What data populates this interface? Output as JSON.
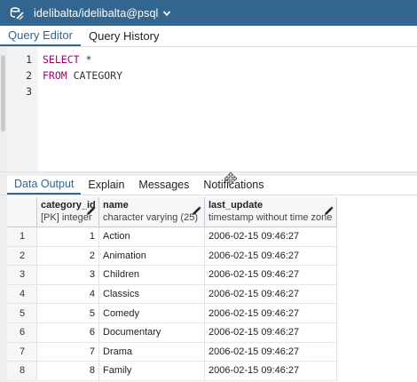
{
  "titlebar": {
    "connection": "idelibalta/idelibalta@psql",
    "db_icon": "database-connect-icon",
    "chevron": "chevron-down-icon",
    "bg_color": "#326690"
  },
  "editor_tabs": [
    {
      "label": "Query Editor",
      "active": true
    },
    {
      "label": "Query History",
      "active": false
    }
  ],
  "editor": {
    "lines": [
      {
        "num": "1",
        "keyword": "SELECT",
        "rest": " *"
      },
      {
        "num": "2",
        "keyword": "FROM",
        "rest": " CATEGORY"
      },
      {
        "num": "3",
        "keyword": "",
        "rest": ""
      }
    ],
    "keyword_color": "#9f0070"
  },
  "output_tabs": [
    {
      "label": "Data Output",
      "active": true
    },
    {
      "label": "Explain",
      "active": false
    },
    {
      "label": "Messages",
      "active": false
    },
    {
      "label": "Notifications",
      "active": false
    }
  ],
  "grid": {
    "columns": [
      {
        "name": "category_id",
        "type": "[PK] integer"
      },
      {
        "name": "name",
        "type": "character varying (25)"
      },
      {
        "name": "last_update",
        "type": "timestamp without time zone"
      }
    ],
    "rows": [
      {
        "n": "1",
        "id": "1",
        "name": "Action",
        "last_update": "2006-02-15 09:46:27"
      },
      {
        "n": "2",
        "id": "2",
        "name": "Animation",
        "last_update": "2006-02-15 09:46:27"
      },
      {
        "n": "3",
        "id": "3",
        "name": "Children",
        "last_update": "2006-02-15 09:46:27"
      },
      {
        "n": "4",
        "id": "4",
        "name": "Classics",
        "last_update": "2006-02-15 09:46:27"
      },
      {
        "n": "5",
        "id": "5",
        "name": "Comedy",
        "last_update": "2006-02-15 09:46:27"
      },
      {
        "n": "6",
        "id": "6",
        "name": "Documentary",
        "last_update": "2006-02-15 09:46:27"
      },
      {
        "n": "7",
        "id": "7",
        "name": "Drama",
        "last_update": "2006-02-15 09:46:27"
      },
      {
        "n": "8",
        "id": "8",
        "name": "Family",
        "last_update": "2006-02-15 09:46:27"
      }
    ]
  }
}
